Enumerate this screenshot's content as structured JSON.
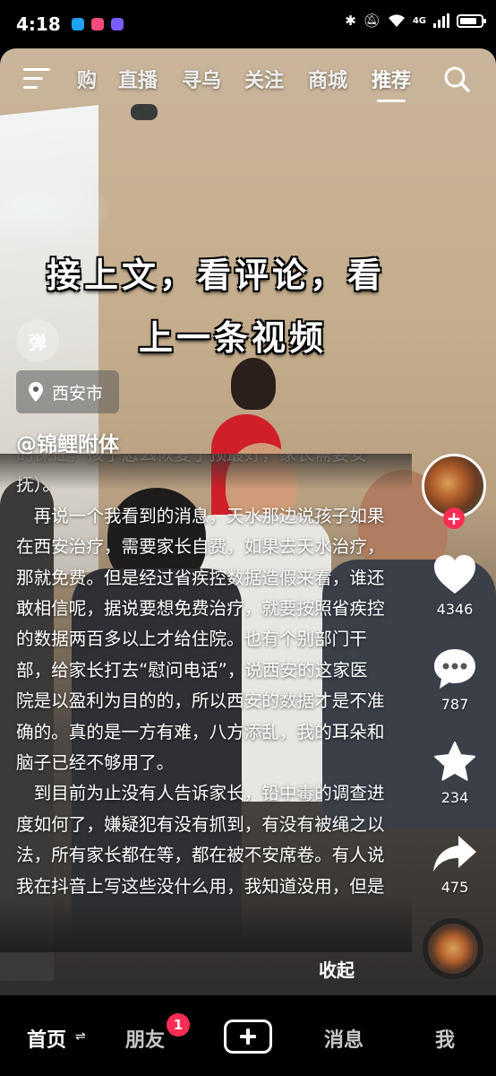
{
  "status_bar": {
    "time": "4:18",
    "network": "4G"
  },
  "top_nav": {
    "tabs": [
      {
        "label": "购",
        "active": false
      },
      {
        "label": "直播",
        "active": false
      },
      {
        "label": "寻乌",
        "active": false
      },
      {
        "label": "关注",
        "active": false
      },
      {
        "label": "商城",
        "active": false
      },
      {
        "label": "推荐",
        "active": true
      }
    ]
  },
  "overlay": {
    "line1": "接上文，看评论，看",
    "line2": "上一条视频"
  },
  "danmu_label": "弹",
  "location": "西安市",
  "author": "@锦鲤附体",
  "description": {
    "first_partial": "的保证，孩子怎么恢复了预最好，家长需要安抚）。",
    "para1": "再说一个我看到的消息，天水那边说孩子如果在西安治疗，需要家长自费，如果去天水治疗，那就免费。但是经过省疾控数据造假来看，谁还敢相信呢，据说要想免费治疗，就要按照省疾控的数据两百多以上才给住院。也有个别部门干部，给家长打去“慰问电话”，说西安的这家医院是以盈利为目的的，所以西安的数据才是不准确的。真的是一方有难，八方添乱，我的耳朵和脑子已经不够用了。",
    "para2": "到目前为止没有人告诉家长，铅中毒的调查进度如何了，嫌疑犯有没有抓到，有没有被绳之以法，所有家长都在等，都在被不安席卷。有人说我在抖音上写这些没什么用，我知道没用，但是"
  },
  "collapse_label": "收起",
  "actions": {
    "likes": "4346",
    "comments": "787",
    "favorites": "234",
    "shares": "475"
  },
  "bottom_nav": {
    "home": "首页",
    "friends": "朋友",
    "friends_badge": "1",
    "messages": "消息",
    "me": "我"
  },
  "colors": {
    "accent": "#fe2c55",
    "background": "#000000"
  }
}
